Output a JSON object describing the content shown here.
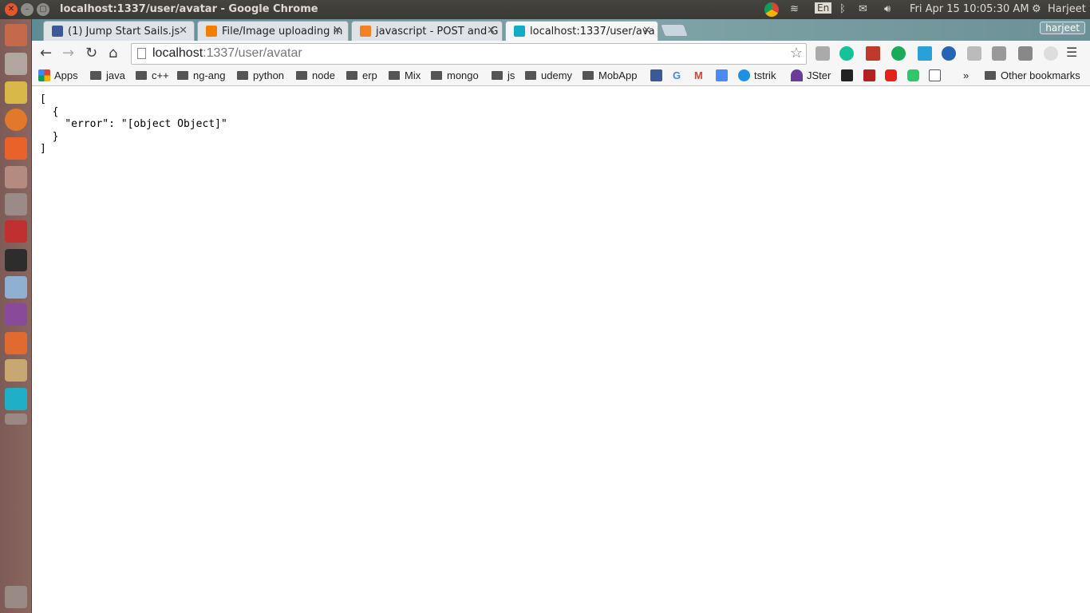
{
  "system": {
    "window_title": "localhost:1337/user/avatar - Google Chrome",
    "keyboard": "En",
    "clock": "Fri Apr 15 10:05:30 AM",
    "user": "Harjeet"
  },
  "tabs": [
    {
      "label": "(1) Jump Start Sails.js",
      "icon": "facebook-icon",
      "color": "#3b5998"
    },
    {
      "label": "File/Image uploading in",
      "icon": "blogger-icon",
      "color": "#f57d00"
    },
    {
      "label": "javascript - POST and G",
      "icon": "stackoverflow-icon",
      "color": "#f48024"
    },
    {
      "label": "localhost:1337/user/ava",
      "icon": "sails-icon",
      "color": "#14acc2",
      "active": true
    }
  ],
  "profile": "harjeet",
  "address": {
    "host": "localhost",
    "path": ":1337/user/avatar"
  },
  "bookmarks": {
    "apps": "Apps",
    "folders": [
      "java",
      "c++",
      "ng-ang",
      "python",
      "node",
      "erp",
      "Mix",
      "mongo",
      "js",
      "udemy",
      "MobApp"
    ],
    "links": [
      "tstrik",
      "JSter"
    ],
    "other": "Other bookmarks",
    "overflow": "»"
  },
  "content": {
    "json_text": "[\n  {\n    \"error\": \"[object Object]\"\n  }\n]"
  }
}
